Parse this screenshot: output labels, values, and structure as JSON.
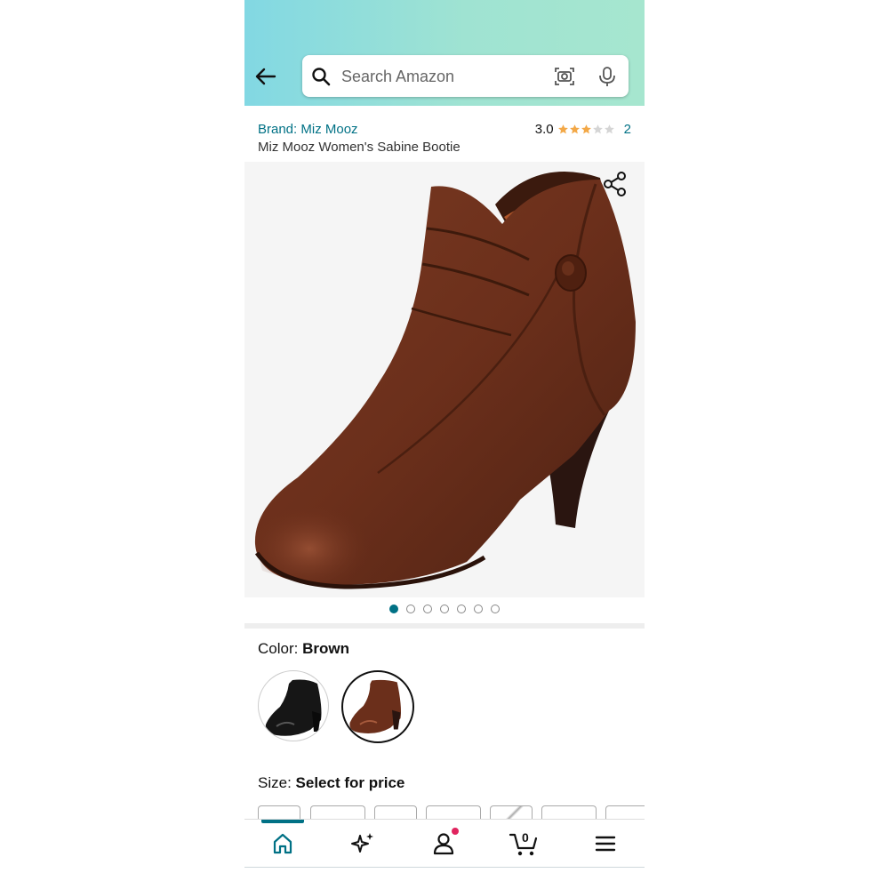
{
  "search": {
    "placeholder": "Search Amazon"
  },
  "product": {
    "brand_link": "Brand: Miz Mooz",
    "title": "Miz Mooz Women's Sabine Bootie",
    "rating_value": "3.0",
    "rating_stars": 3,
    "rating_count": "2"
  },
  "gallery": {
    "image_count": 7,
    "active_index": 0
  },
  "color": {
    "label": "Color: ",
    "selected": "Brown",
    "options": [
      "Black",
      "Brown"
    ]
  },
  "size": {
    "label": "Size: ",
    "selected": "Select for price"
  },
  "nav": {
    "cart_count": "0"
  },
  "colors": {
    "accent": "#007185",
    "star": "#f3a847",
    "boot": "#6b3420",
    "notification": "#e0245e"
  }
}
